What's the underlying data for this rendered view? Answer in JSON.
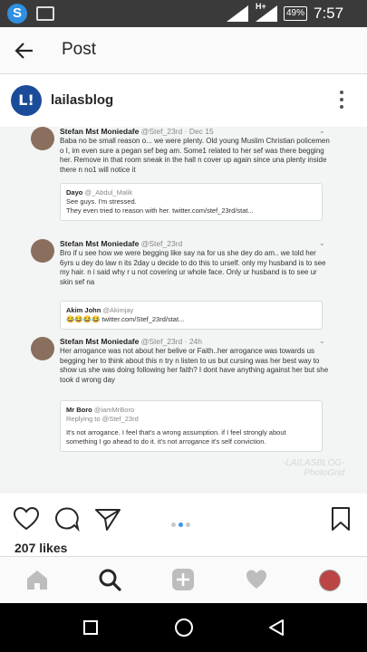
{
  "status_bar": {
    "network": "H+",
    "battery": "49%",
    "time": "7:57 pm"
  },
  "header": {
    "title": "Post"
  },
  "profile": {
    "username": "lailasblog",
    "avatar_text": "L!"
  },
  "post": {
    "tweets": [
      {
        "name": "Stefan Mst Moniedafe",
        "handle": "@Stef_23rd",
        "time": "· Dec 15",
        "text": "Baba no be small reason o... we were plenty. Old young Muslim Christian policemen o I, im even sure a pegan sef beg am. Some1 related to her sef was there begging her. Remove in that room sneak in the hall n cover up again since una plenty inside there n no1 will notice it",
        "quote": {
          "name": "Dayo",
          "handle": "@_Abdul_Malik",
          "lines": [
            "See guys. I'm stressed.",
            "They even tried to reason with her. twitter.com/stef_23rd/stat..."
          ]
        }
      },
      {
        "name": "Stefan Mst Moniedafe",
        "handle": "@Stef_23rd",
        "time": "",
        "text": "Bro if u see how we were begging like say na for us she dey do am.. we told her 6yrs u dey do law n its 2day u decide to do this to urself. only my husband is to see my hair. n i said why r u not covering ur whole face. Only ur husband is to see ur skin sef na",
        "quote": {
          "name": "Akim John",
          "handle": "@Akimjay",
          "lines": [
            "😂😂😂😂 twitter.com/Stef_23rd/stat..."
          ]
        }
      },
      {
        "name": "Stefan Mst Moniedafe",
        "handle": "@Stef_23rd",
        "time": "· 24h",
        "text": "Her arrogance was not about her belive or Faith..her arrogance was towards us begging her to think about this n try n listen to us but cursing was her best way to show us she was doing following her faith? I dont have anything against her but she took d wrong day",
        "quote": {
          "name": "Mr Boro",
          "handle": "@iamMrBoro",
          "reply": "Replying to @Stef_23rd",
          "lines": [
            "It's not arrogance. I feel that's a wrong assumption. if I feel strongly about something I go ahead to do it. it's not arrogance it's self conviction."
          ]
        }
      }
    ],
    "watermark_line1": "-LAILASBLOG-",
    "watermark_line2": "PhotoGrid"
  },
  "likes": "207 likes",
  "icons": {
    "back": "arrow-left-icon",
    "more": "more-vertical-icon",
    "like": "heart-icon",
    "comment": "comment-bubble-icon",
    "share": "send-icon",
    "save": "bookmark-icon",
    "home": "home-icon",
    "search": "search-icon",
    "add": "add-post-icon",
    "activity": "heart-icon"
  },
  "accent_color": "#3897f0"
}
